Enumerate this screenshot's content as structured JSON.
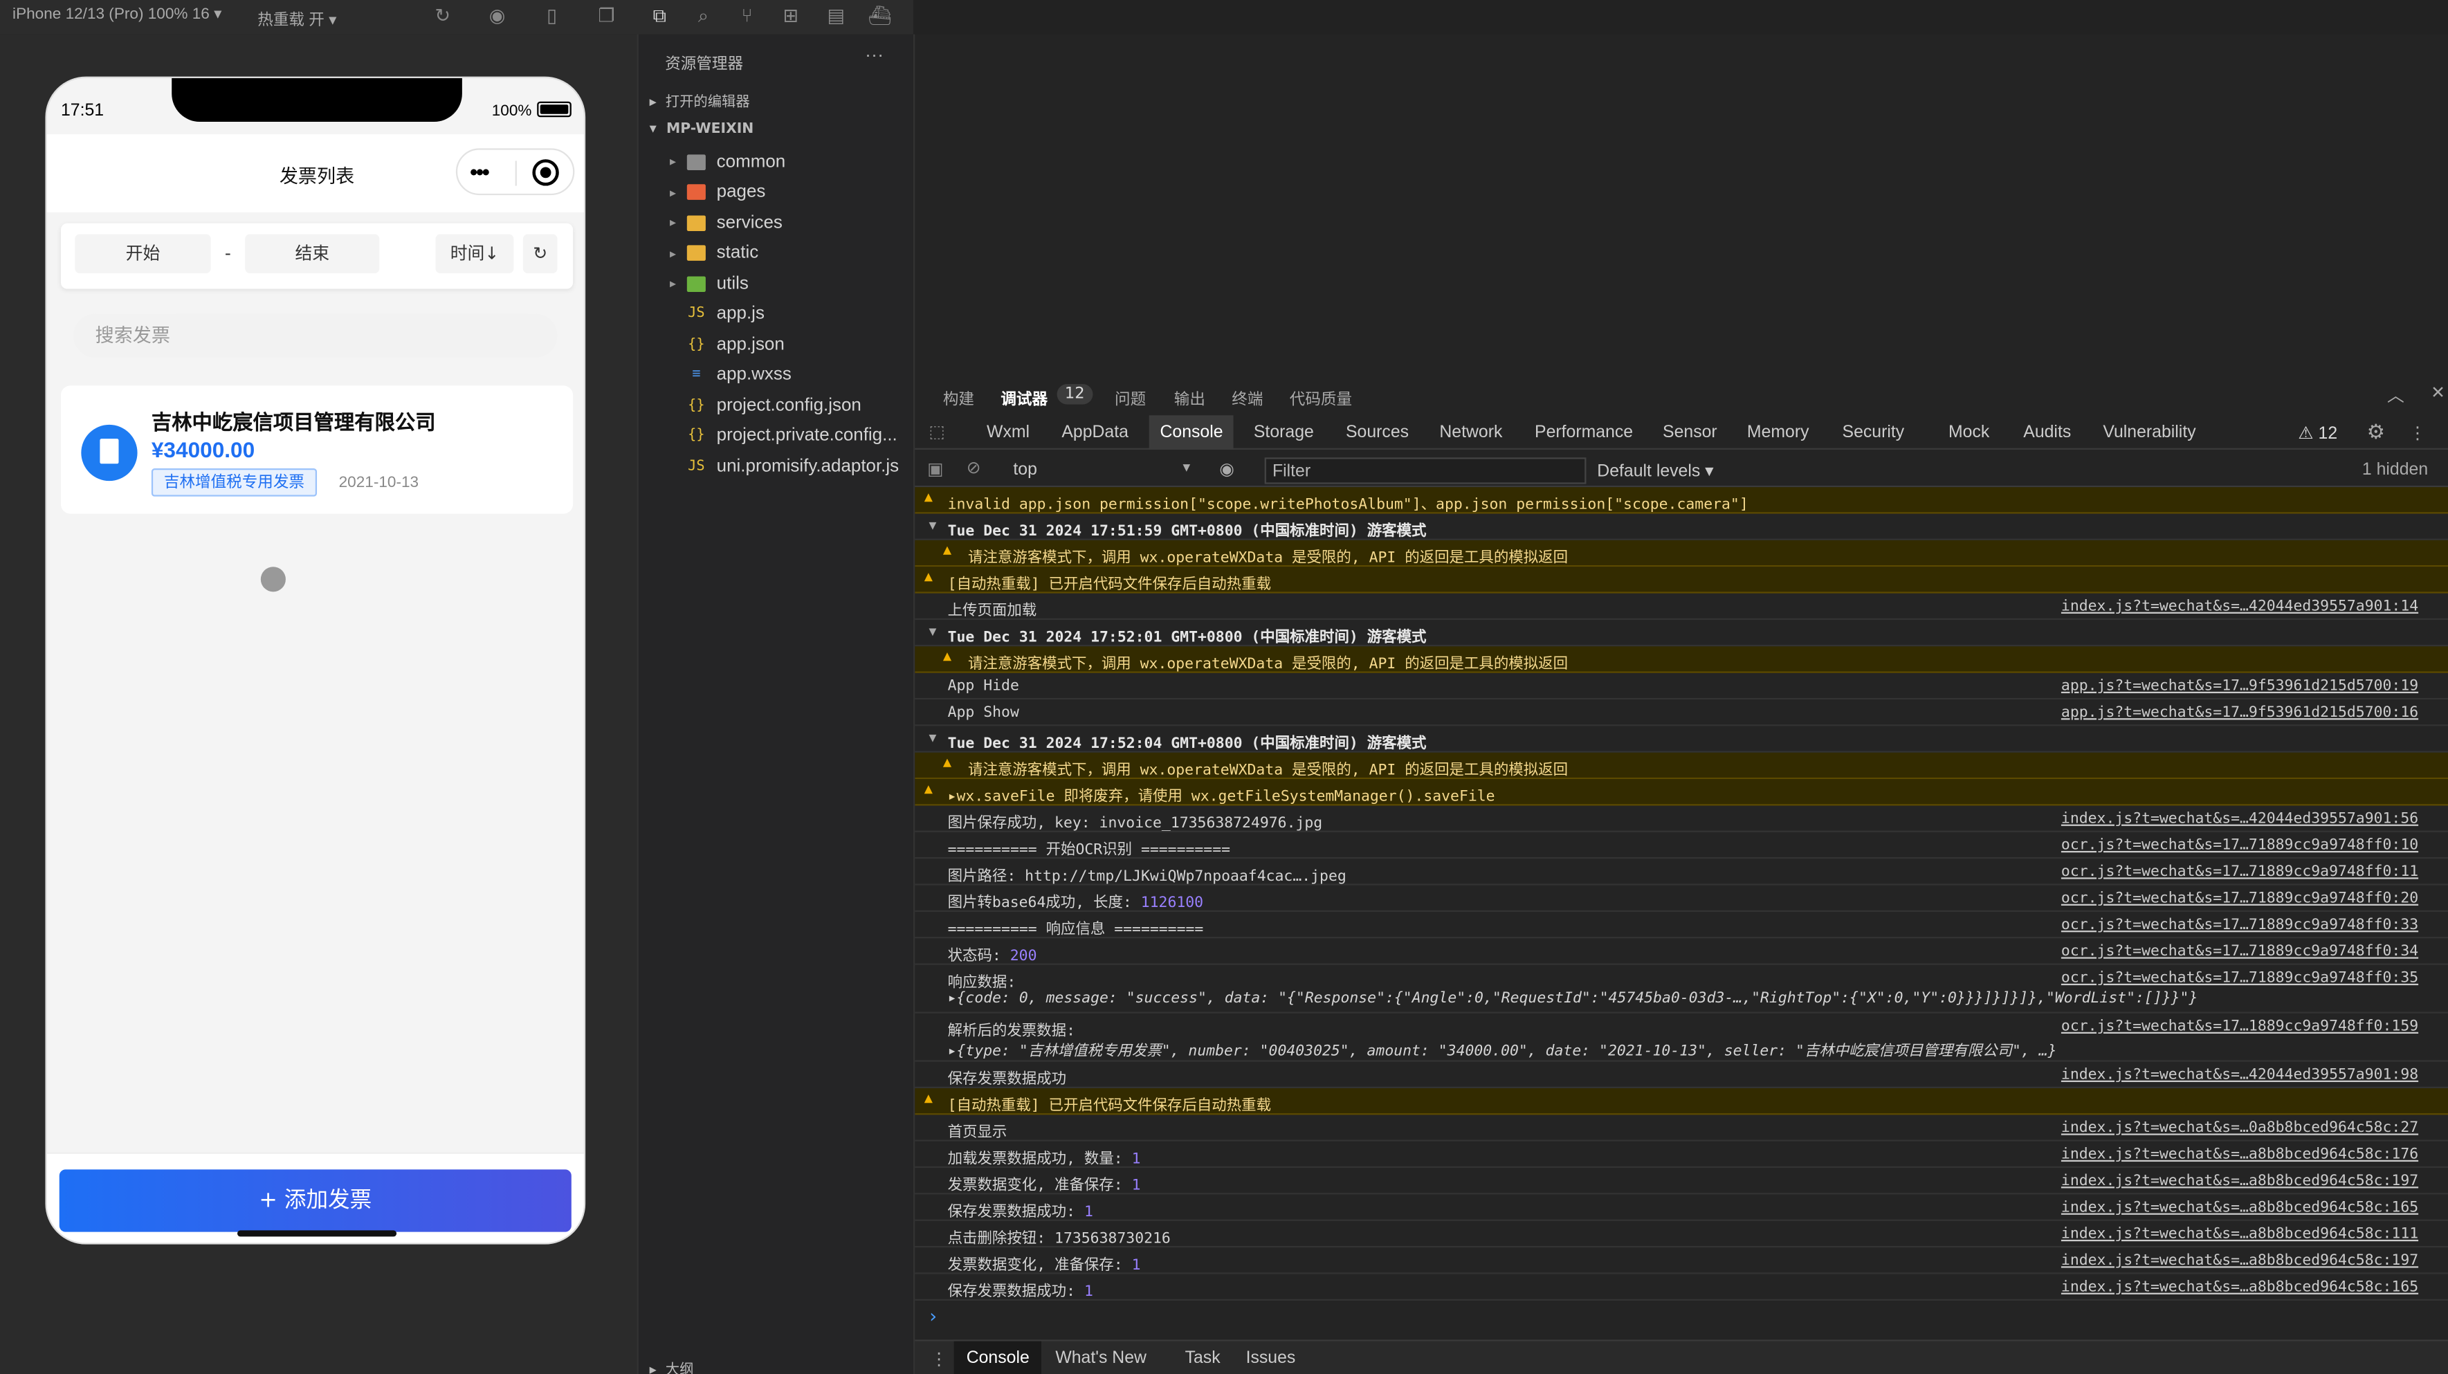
{
  "topbar": {
    "device": "iPhone 12/13 (Pro) 100% 16 ▾",
    "hot_reload": "热重载 开 ▾"
  },
  "phone": {
    "time": "17:51",
    "battery": "100%",
    "title": "发票列表",
    "filter": {
      "start": "开始",
      "dash": "-",
      "end": "结束",
      "sort": "时间↓",
      "refresh": "↻"
    },
    "search_placeholder": "搜索发票",
    "invoice": {
      "company": "吉林中屹宸信项目管理有限公司",
      "amount": "¥34000.00",
      "type": "吉林增值税专用发票",
      "date": "2021-10-13"
    },
    "add_button": "+ 添加发票"
  },
  "explorer": {
    "header": "资源管理器",
    "more": "···",
    "open_editors": "打开的编辑器",
    "project": "MP-WEIXIN",
    "outline": "大纲",
    "items": [
      {
        "name": "common",
        "kind": "folder",
        "color": "#8c8c8c"
      },
      {
        "name": "pages",
        "kind": "folder",
        "color": "#e8623b"
      },
      {
        "name": "services",
        "kind": "folder",
        "color": "#e8b13b"
      },
      {
        "name": "static",
        "kind": "folder",
        "color": "#e8b13b"
      },
      {
        "name": "utils",
        "kind": "folder",
        "color": "#6cb33f"
      },
      {
        "name": "app.js",
        "kind": "js",
        "icon": "JS",
        "color": "#e8c13b"
      },
      {
        "name": "app.json",
        "kind": "json",
        "icon": "{}",
        "color": "#e8c13b"
      },
      {
        "name": "app.wxss",
        "kind": "css",
        "icon": "≡",
        "color": "#4a90e2"
      },
      {
        "name": "project.config.json",
        "kind": "json",
        "icon": "{}",
        "color": "#e8c13b"
      },
      {
        "name": "project.private.config...",
        "kind": "json",
        "icon": "{}",
        "color": "#e8c13b"
      },
      {
        "name": "uni.promisify.adaptor.js",
        "kind": "js",
        "icon": "JS",
        "color": "#e8c13b"
      }
    ]
  },
  "devtools": {
    "tabs_top": [
      "构建",
      "调试器",
      "12",
      "问题",
      "输出",
      "终端",
      "代码质量"
    ],
    "tabs_panel": [
      "Wxml",
      "AppData",
      "Console",
      "Sources",
      "Network",
      "Performance",
      "Sensor",
      "Memory",
      "Security",
      "Mock",
      "Audits",
      "Vulnerability"
    ],
    "tab_storage": "Storage",
    "warnings_count": "⚠ 12",
    "context": "top",
    "filter_placeholder": "Filter",
    "levels": "Default levels ▾",
    "hidden": "1 hidden",
    "bottom_tabs": [
      "Console",
      "What's New",
      "Task",
      "Issues"
    ],
    "lines": [
      {
        "t": "w",
        "text": "invalid app.json permission[\"scope.writePhotosAlbum\"]、app.json permission[\"scope.camera\"]"
      },
      {
        "t": "h",
        "text": "Tue Dec 31 2024 17:51:59 GMT+0800 (中国标准时间) 游客模式"
      },
      {
        "t": "w2",
        "text": "请注意游客模式下，调用 wx.operateWXData 是受限的, API 的返回是工具的模拟返回"
      },
      {
        "t": "w",
        "text": "[自动热重载] 已开启代码文件保存后自动热重载"
      },
      {
        "t": "n",
        "text": "上传页面加载",
        "src": "index.js?t=wechat&s=…42044ed39557a901:14"
      },
      {
        "t": "h",
        "text": "Tue Dec 31 2024 17:52:01 GMT+0800 (中国标准时间) 游客模式"
      },
      {
        "t": "w2",
        "text": "请注意游客模式下，调用 wx.operateWXData 是受限的, API 的返回是工具的模拟返回"
      },
      {
        "t": "n",
        "text": "App Hide",
        "src": "app.js?t=wechat&s=17…9f53961d215d5700:19"
      },
      {
        "t": "n",
        "text": "App Show",
        "src": "app.js?t=wechat&s=17…9f53961d215d5700:16"
      },
      {
        "t": "h",
        "text": "Tue Dec 31 2024 17:52:04 GMT+0800 (中国标准时间) 游客模式"
      },
      {
        "t": "w2",
        "text": "请注意游客模式下，调用 wx.operateWXData 是受限的, API 的返回是工具的模拟返回"
      },
      {
        "t": "w",
        "text": "▸wx.saveFile 即将废弃，请使用 wx.getFileSystemManager().saveFile"
      },
      {
        "t": "n",
        "text": "图片保存成功, key: invoice_1735638724976.jpg",
        "src": "index.js?t=wechat&s=…42044ed39557a901:56"
      },
      {
        "t": "n",
        "text": "========== 开始OCR识别 ==========",
        "src": "ocr.js?t=wechat&s=17…71889cc9a9748ff0:10"
      },
      {
        "t": "n",
        "text": "图片路径: http://tmp/LJKwiQWp7npoaaf4cac….jpeg",
        "src": "ocr.js?t=wechat&s=17…71889cc9a9748ff0:11"
      },
      {
        "t": "n",
        "text": "图片转base64成功, 长度: ",
        "num": "1126100",
        "src": "ocr.js?t=wechat&s=17…71889cc9a9748ff0:20"
      },
      {
        "t": "n",
        "text": "========== 响应信息 ==========",
        "src": "ocr.js?t=wechat&s=17…71889cc9a9748ff0:33"
      },
      {
        "t": "n",
        "text": "状态码: ",
        "num": "200",
        "src": "ocr.js?t=wechat&s=17…71889cc9a9748ff0:34"
      },
      {
        "t": "n2",
        "text": "响应数据:",
        "sub": "▸{code: 0, message: \"success\", data: \"{\"Response\":{\"Angle\":0,\"RequestId\":\"45745ba0-03d3-…,\"RightTop\":{\"X\":0,\"Y\":0}}}]}]}]},\"WordList\":[]}}\"}",
        "src": "ocr.js?t=wechat&s=17…71889cc9a9748ff0:35"
      },
      {
        "t": "n2",
        "text": "解析后的发票数据:",
        "sub": "▸{type: \"吉林增值税专用发票\", number: \"00403025\", amount: \"34000.00\", date: \"2021-10-13\", seller: \"吉林中屹宸信项目管理有限公司\", …}",
        "src": "ocr.js?t=wechat&s=17…1889cc9a9748ff0:159"
      },
      {
        "t": "n",
        "text": "保存发票数据成功",
        "src": "index.js?t=wechat&s=…42044ed39557a901:98"
      },
      {
        "t": "w",
        "text": "[自动热重载] 已开启代码文件保存后自动热重载"
      },
      {
        "t": "n",
        "text": "首页显示",
        "src": "index.js?t=wechat&s=…0a8b8bced964c58c:27"
      },
      {
        "t": "n",
        "text": "加载发票数据成功, 数量: ",
        "num": "1",
        "src": "index.js?t=wechat&s=…a8b8bced964c58c:176"
      },
      {
        "t": "n",
        "text": "发票数据变化, 准备保存: ",
        "num": "1",
        "src": "index.js?t=wechat&s=…a8b8bced964c58c:197"
      },
      {
        "t": "n",
        "text": "保存发票数据成功: ",
        "num": "1",
        "src": "index.js?t=wechat&s=…a8b8bced964c58c:165"
      },
      {
        "t": "n",
        "text": "点击删除按钮: 1735638730216",
        "src": "index.js?t=wechat&s=…a8b8bced964c58c:111"
      },
      {
        "t": "n",
        "text": "发票数据变化, 准备保存: ",
        "num": "1",
        "src": "index.js?t=wechat&s=…a8b8bced964c58c:197"
      },
      {
        "t": "n",
        "text": "保存发票数据成功: ",
        "num": "1",
        "src": "index.js?t=wechat&s=…a8b8bced964c58c:165"
      }
    ],
    "prompt": "›"
  }
}
